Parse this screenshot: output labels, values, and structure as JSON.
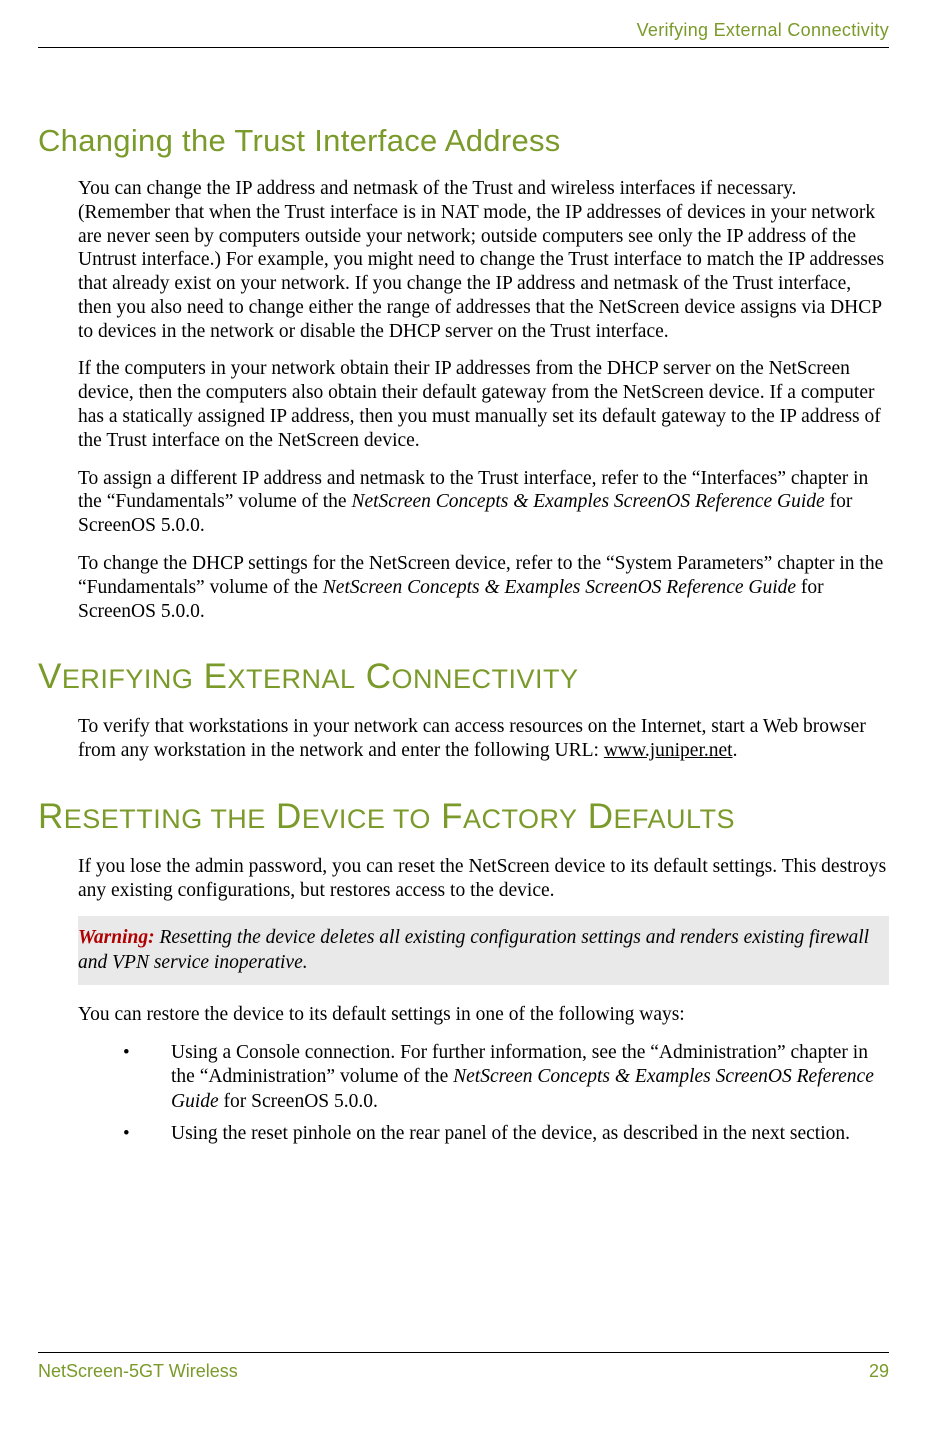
{
  "header": {
    "running_title": "Verifying External Connectivity"
  },
  "section1": {
    "title": "Changing the Trust Interface Address",
    "p1": "You can change the IP address and netmask of the Trust and wireless interfaces if necessary. (Remember that when the Trust interface is in NAT mode, the IP addresses of devices in your network are never seen by computers outside your network; outside computers see only the IP address of the Untrust interface.) For example, you might need to change the Trust interface to match the IP addresses that already exist on your network. If you change the IP address and netmask of the Trust interface, then you also need to change either the range of addresses that the NetScreen device assigns via DHCP to devices in the network or disable the DHCP server on the Trust interface.",
    "p2": "If the computers in your network obtain their IP addresses from the DHCP server on the NetScreen device, then the computers also obtain their default gateway from the NetScreen device. If a computer has a statically assigned IP address, then you must manually set its default gateway to the IP address of the Trust interface on the NetScreen device.",
    "p3_a": "To assign a different IP address and netmask to the Trust interface, refer to the “Interfaces” chapter in the “Fundamentals” volume of the ",
    "p3_ref": "NetScreen Concepts & Examples ScreenOS Reference Guide",
    "p3_b": " for ScreenOS 5.0.0.",
    "p4_a": "To change the DHCP settings for the NetScreen device, refer to the “System Parameters” chapter in the “Fundamentals” volume of the ",
    "p4_ref": "NetScreen Concepts & Examples ScreenOS Reference Guide",
    "p4_b": " for ScreenOS 5.0.0."
  },
  "section2": {
    "heading_parts": [
      "V",
      "ERIFYING",
      " E",
      "XTERNAL",
      " C",
      "ONNECTIVITY"
    ],
    "p1_a": "To verify that workstations in your network can access resources on the Internet, start a Web browser from any workstation in the network and enter the following URL: ",
    "p1_link": "www.juniper.net",
    "p1_b": "."
  },
  "section3": {
    "heading_parts": [
      "R",
      "ESETTING",
      " ",
      "THE",
      " D",
      "EVICE",
      " ",
      "TO",
      " F",
      "ACTORY",
      " D",
      "EFAULTS"
    ],
    "p1": "If you lose the admin password, you can reset the NetScreen device to its default settings. This destroys any existing configurations, but restores access to the device.",
    "warning_label": "Warning:",
    "warning_text": " Resetting the device deletes all existing configuration settings and renders existing firewall and VPN service inoperative.",
    "p2": "You can restore the device to its default settings in one of the following ways:",
    "bullets": [
      {
        "a": "Using a Console connection. For further information, see the “Administration” chapter in the “Administration” volume of the ",
        "ref": "NetScreen Concepts & Examples ScreenOS Reference Guide",
        "b": " for ScreenOS 5.0.0."
      },
      {
        "a": "Using the reset pinhole on the rear panel of the device, as described in the next section.",
        "ref": "",
        "b": ""
      }
    ]
  },
  "footer": {
    "product": "NetScreen-5GT Wireless",
    "page": "29"
  }
}
